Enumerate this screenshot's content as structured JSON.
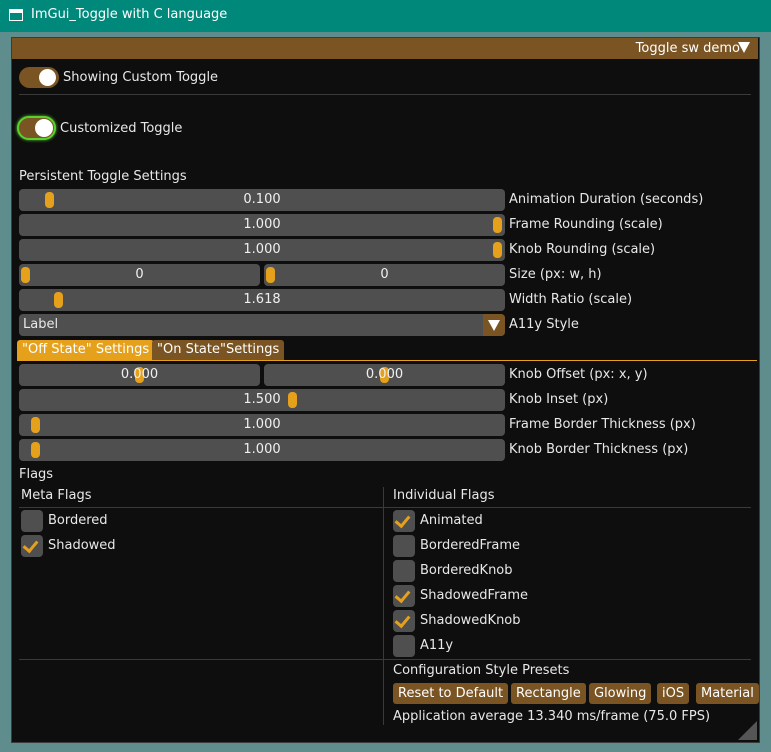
{
  "window_title": "ImGui_Toggle with C language",
  "panel_title": "Toggle sw demo",
  "custom_toggle_label": "Showing Custom Toggle",
  "customized_toggle_label": "Customized Toggle",
  "persistent_header": "Persistent Toggle Settings",
  "sliders": {
    "animation": {
      "value": "0.100",
      "label": "Animation Duration (seconds)"
    },
    "frame_rounding": {
      "value": "1.000",
      "label": "Frame Rounding (scale)"
    },
    "knob_rounding": {
      "value": "1.000",
      "label": "Knob Rounding (scale)"
    },
    "size": {
      "w": "0",
      "h": "0",
      "label": "Size (px: w, h)"
    },
    "width_ratio": {
      "value": "1.618",
      "label": "Width Ratio (scale)"
    }
  },
  "a11y": {
    "selected": "Label",
    "label": "A11y Style"
  },
  "tabs": [
    "\"Off State\" Settings",
    "\"On State\"Settings"
  ],
  "state_sliders": {
    "knob_offset": {
      "x": "0.000",
      "y": "0.000",
      "label": "Knob Offset (px: x, y)"
    },
    "knob_inset": {
      "value": "1.500",
      "label": "Knob Inset (px)"
    },
    "frame_border": {
      "value": "1.000",
      "label": "Frame Border Thickness (px)"
    },
    "knob_border": {
      "value": "1.000",
      "label": "Knob Border Thickness (px)"
    }
  },
  "flags_header": "Flags",
  "meta_flags": {
    "header": "Meta Flags",
    "items": [
      {
        "label": "Bordered",
        "checked": false
      },
      {
        "label": "Shadowed",
        "checked": true
      }
    ]
  },
  "individual_flags": {
    "header": "Individual Flags",
    "items": [
      {
        "label": "Animated",
        "checked": true
      },
      {
        "label": "BorderedFrame",
        "checked": false
      },
      {
        "label": "BorderedKnob",
        "checked": false
      },
      {
        "label": "ShadowedFrame",
        "checked": true
      },
      {
        "label": "ShadowedKnob",
        "checked": true
      },
      {
        "label": "A11y",
        "checked": false
      }
    ]
  },
  "presets": {
    "header": "Configuration Style Presets",
    "buttons": [
      "Reset to Default",
      "Rectangle",
      "Glowing",
      "iOS",
      "Material"
    ]
  },
  "fps_text": "Application average 13.340 ms/frame (75.0 FPS)",
  "colors": {
    "accent": "#e5a11c",
    "title_bg": "#7a5422",
    "os_titlebar": "#00897b",
    "toggle_glow": "#5ad02e"
  }
}
